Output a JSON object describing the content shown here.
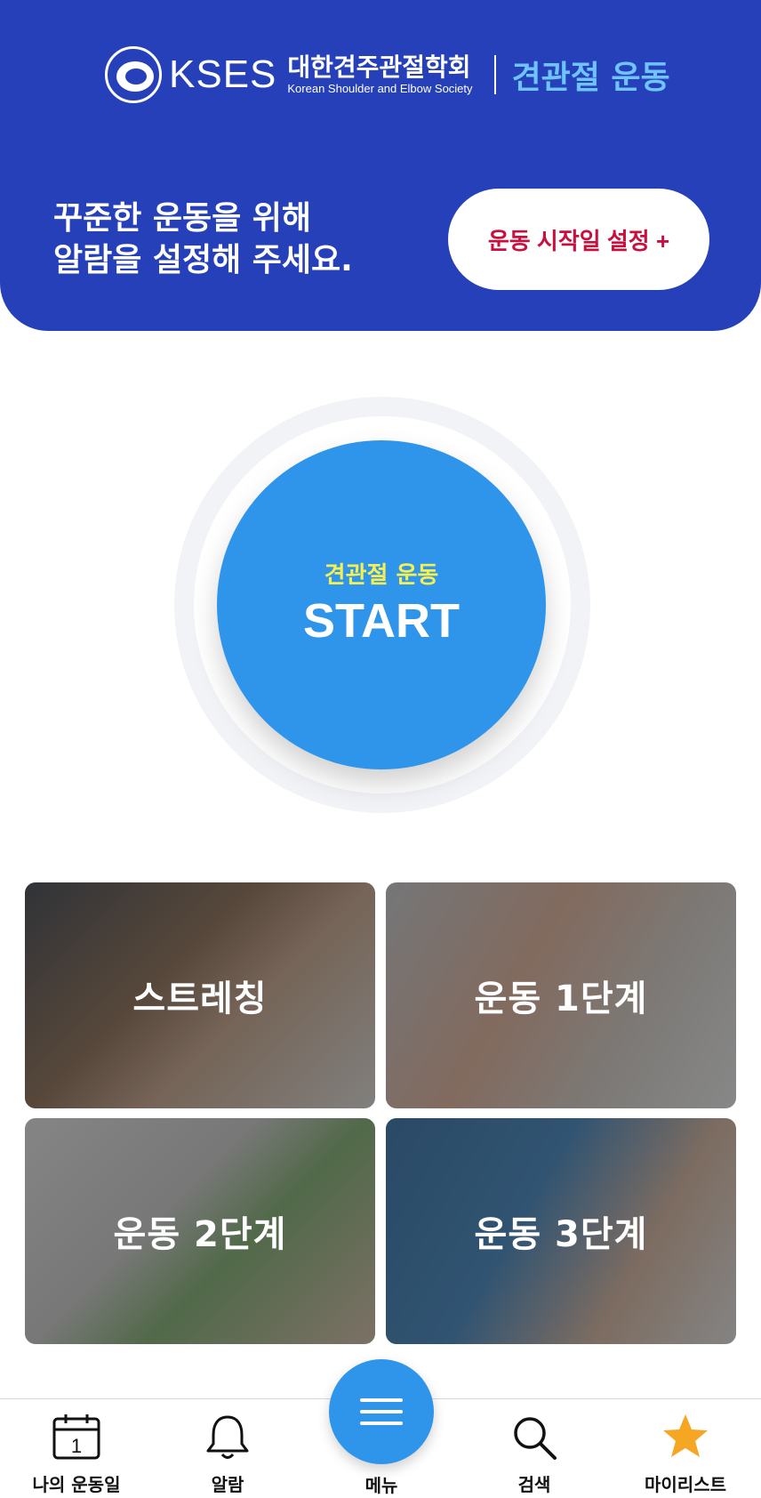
{
  "header": {
    "brand_abbr": "KSES",
    "brand_name_ko": "대한견주관절학회",
    "brand_name_en": "Korean Shoulder and Elbow Society",
    "brand_sub": "견관절 운동",
    "alarm_line1": "꾸준한 운동을 위해",
    "alarm_line2": "알람을 설정해 주세요.",
    "alarm_button": "운동 시작일 설정 +"
  },
  "start": {
    "sub": "견관절 운동",
    "label": "START"
  },
  "cards": [
    {
      "label": "스트레칭"
    },
    {
      "label": "운동 1단계"
    },
    {
      "label": "운동 2단계"
    },
    {
      "label": "운동 3단계"
    }
  ],
  "nav": {
    "my_days": "나의 운동일",
    "calendar_day": "1",
    "alarm": "알람",
    "menu": "메뉴",
    "search": "검색",
    "mylist": "마이리스트"
  },
  "colors": {
    "header_bg": "#2540b8",
    "accent_blue": "#2f95ea",
    "alarm_btn_text": "#c8103e",
    "start_sub": "#f6ef53",
    "star": "#f5a623"
  }
}
